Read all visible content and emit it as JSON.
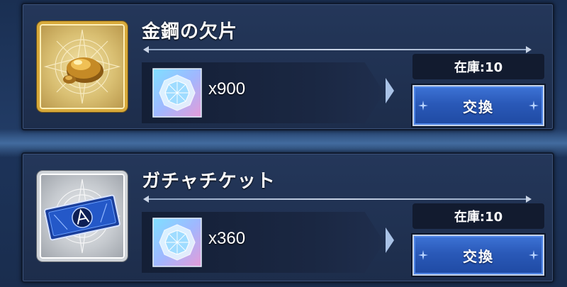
{
  "shop_items": [
    {
      "name": "金鋼の欠片",
      "cost_currency_icon": "crystal-icon",
      "cost_amount": "x900",
      "stock": "在庫:10",
      "exchange_label": "交換",
      "item_icon": "gold-nugget-icon",
      "frame_color": "#d7a93a"
    },
    {
      "name": "ガチャチケット",
      "cost_currency_icon": "crystal-icon",
      "cost_amount": "x360",
      "stock": "在庫:10",
      "exchange_label": "交換",
      "item_icon": "gacha-ticket-icon",
      "frame_color": "#cfd3d8"
    }
  ],
  "colors": {
    "button_blue": "#2a59b8",
    "panel_bg": "#1d2d4b"
  }
}
